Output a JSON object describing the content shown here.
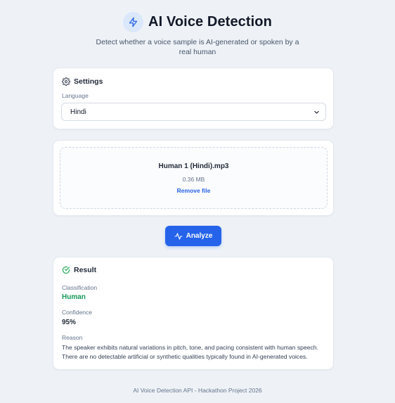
{
  "header": {
    "title": "AI Voice Detection",
    "logo_icon": "lightning-bolt-icon",
    "subtitle_line1": "Detect whether a voice sample is AI-generated or spoken by a",
    "subtitle_line2": "real human"
  },
  "settings": {
    "heading": "Settings",
    "heading_icon": "gear-icon",
    "language_label": "Language",
    "language_value": "Hindi"
  },
  "upload": {
    "file_name": "Human 1 (Hindi).mp3",
    "file_size": "0.36 MB",
    "remove_label": "Remove file"
  },
  "analyze": {
    "label": "Analyze",
    "icon": "activity-pulse-icon"
  },
  "result": {
    "heading": "Result",
    "heading_icon": "check-circle-icon",
    "classification_label": "Classification",
    "classification_value": "Human",
    "classification_color": "#159957",
    "confidence_label": "Confidence",
    "confidence_value": "95%",
    "reason_label": "Reason",
    "reason_text": "The speaker exhibits natural variations in pitch, tone, and pacing consistent with human speech. There are no detectable artificial or synthetic qualities typically found in AI-generated voices."
  },
  "footer": {
    "text": "AI Voice Detection API - Hackathon Project 2026"
  },
  "colors": {
    "accent": "#2563eb",
    "background": "#eef2f7",
    "success": "#159957"
  }
}
